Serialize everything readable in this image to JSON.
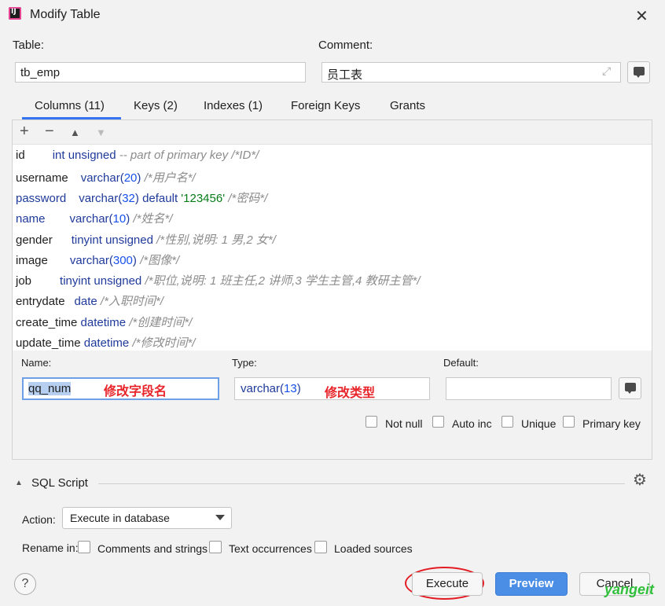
{
  "window": {
    "title": "Modify Table"
  },
  "table": {
    "label": "Table:",
    "value": "tb_emp"
  },
  "comment": {
    "label": "Comment:",
    "value": "员工表"
  },
  "tabs": [
    {
      "label": "Columns (11)",
      "active": true
    },
    {
      "label": "Keys (2)"
    },
    {
      "label": "Indexes (1)"
    },
    {
      "label": "Foreign Keys"
    },
    {
      "label": "Grants"
    }
  ],
  "toolbar": {
    "add": "+",
    "remove": "−",
    "up": "▲",
    "down": "▼"
  },
  "columns": [
    {
      "name": "id",
      "type": "int unsigned",
      "comment": "-- part of primary key /*ID*/"
    },
    {
      "name": "username",
      "type_kw": "varchar(",
      "type_num": "20",
      "type_end": ")",
      "comment": "/*用户名*/"
    },
    {
      "name": "password",
      "type_kw": "varchar(",
      "type_num": "32",
      "type_end": ") default",
      "default": "'123456'",
      "comment": "/*密码*/"
    },
    {
      "name": "name",
      "type_kw": "varchar(",
      "type_num": "10",
      "type_end": ")",
      "comment": "/*姓名*/"
    },
    {
      "name": "gender",
      "type": "tinyint unsigned",
      "comment": "/*性别,说明: 1 男,2 女*/"
    },
    {
      "name": "image",
      "type_kw": "varchar(",
      "type_num": "300",
      "type_end": ")",
      "comment": "/*图像*/"
    },
    {
      "name": "job",
      "type": "tinyint unsigned",
      "comment": "/*职位,说明: 1 班主任,2 讲师,3 学生主管,4 教研主管*/"
    },
    {
      "name": "entrydate",
      "type": "date",
      "comment": "/*入职时间*/"
    },
    {
      "name": "create_time",
      "type": "datetime",
      "comment": "/*创建时间*/"
    },
    {
      "name": "update_time",
      "type": "datetime",
      "comment": "/*修改时间*/"
    }
  ],
  "editor": {
    "name_label": "Name:",
    "name_value": "qq_num",
    "name_note": "修改字段名",
    "type_label": "Type:",
    "type_kw": "varchar(",
    "type_num": "13",
    "type_end": ")",
    "type_note": "修改类型",
    "default_label": "Default:",
    "default_value": "",
    "checkboxes": [
      "Not null",
      "Auto inc",
      "Unique",
      "Primary key"
    ]
  },
  "sql_script": {
    "label": "SQL Script"
  },
  "action": {
    "label": "Action:",
    "value": "Execute in database"
  },
  "rename": {
    "label": "Rename in:",
    "options": [
      "Comments and strings",
      "Text occurrences",
      "Loaded sources"
    ]
  },
  "buttons": {
    "help": "?",
    "execute": "Execute",
    "preview": "Preview",
    "cancel": "Cancel"
  },
  "watermark": "yangeit",
  "colors": {
    "accent": "#3574f0",
    "highlight": "#e8252b",
    "primary_button": "#4a8ee6"
  }
}
